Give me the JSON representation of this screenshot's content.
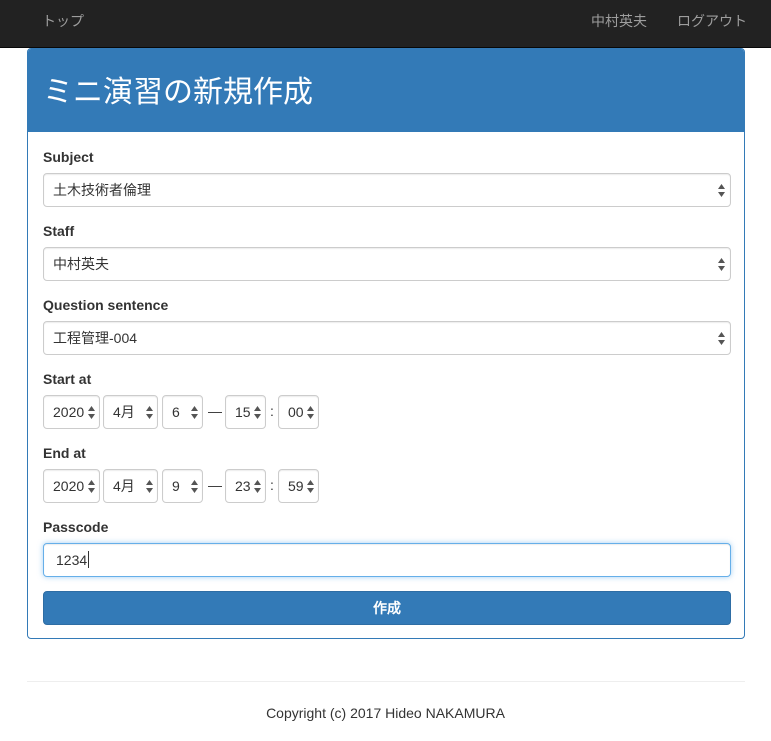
{
  "navbar": {
    "home_label": "トップ",
    "user_label": "中村英夫",
    "logout_label": "ログアウト"
  },
  "panel": {
    "title": "ミニ演習の新規作成"
  },
  "form": {
    "subject": {
      "label": "Subject",
      "value": "土木技術者倫理"
    },
    "staff": {
      "label": "Staff",
      "value": "中村英夫"
    },
    "question": {
      "label": "Question sentence",
      "value": "工程管理-004"
    },
    "start_at": {
      "label": "Start at",
      "year": "2020",
      "month": "4月",
      "day": "6",
      "hour": "15",
      "minute": "00"
    },
    "end_at": {
      "label": "End at",
      "year": "2020",
      "month": "4月",
      "day": "9",
      "hour": "23",
      "minute": "59"
    },
    "date_separator": "—",
    "time_separator": ":",
    "passcode": {
      "label": "Passcode",
      "value": "1234"
    },
    "submit_label": "作成"
  },
  "footer": {
    "copyright": "Copyright (c) 2017 Hideo NAKAMURA"
  },
  "colors": {
    "primary": "#337ab7",
    "navbar": "#222222",
    "nav_text": "#9d9d9d",
    "focus": "#66afe9"
  }
}
